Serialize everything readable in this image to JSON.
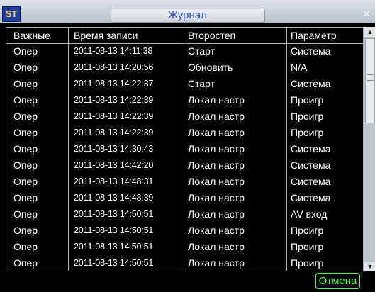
{
  "window": {
    "title": "Журнал",
    "logo": "ST",
    "close_icon": "close-icon"
  },
  "table": {
    "columns": [
      "Важные",
      "Время записи",
      "Второстеп",
      "Параметр"
    ],
    "rows": [
      [
        "Опер",
        "2011-08-13 14:11:38",
        "Старт",
        "Система"
      ],
      [
        "Опер",
        "2011-08-13 14:20:56",
        "Обновить",
        "N/A"
      ],
      [
        "Опер",
        "2011-08-13 14:22:37",
        "Старт",
        "Система"
      ],
      [
        "Опер",
        "2011-08-13 14:22:39",
        "Локал настр",
        "Проигр"
      ],
      [
        "Опер",
        "2011-08-13 14:22:39",
        "Локал настр",
        "Проигр"
      ],
      [
        "Опер",
        "2011-08-13 14:22:39",
        "Локал настр",
        "Проигр"
      ],
      [
        "Опер",
        "2011-08-13 14:30:43",
        "Локал настр",
        "Система"
      ],
      [
        "Опер",
        "2011-08-13 14:42:20",
        "Локал настр",
        "Система"
      ],
      [
        "Опер",
        "2011-08-13 14:48:31",
        "Локал настр",
        "Система"
      ],
      [
        "Опер",
        "2011-08-13 14:48:39",
        "Локал настр",
        "Система"
      ],
      [
        "Опер",
        "2011-08-13 14:50:51",
        "Локал настр",
        "AV вход"
      ],
      [
        "Опер",
        "2011-08-13 14:50:51",
        "Локал настр",
        "Проигр"
      ],
      [
        "Опер",
        "2011-08-13 14:50:51",
        "Локал настр",
        "Проигр"
      ],
      [
        "Опер",
        "2011-08-13 14:50:51",
        "Локал настр",
        "Проигр"
      ]
    ]
  },
  "footer": {
    "cancel_label": "Отмена"
  },
  "colors": {
    "title_text": "#2b4fc9",
    "cancel_accent": "#48ff3c",
    "background": "#000000"
  }
}
